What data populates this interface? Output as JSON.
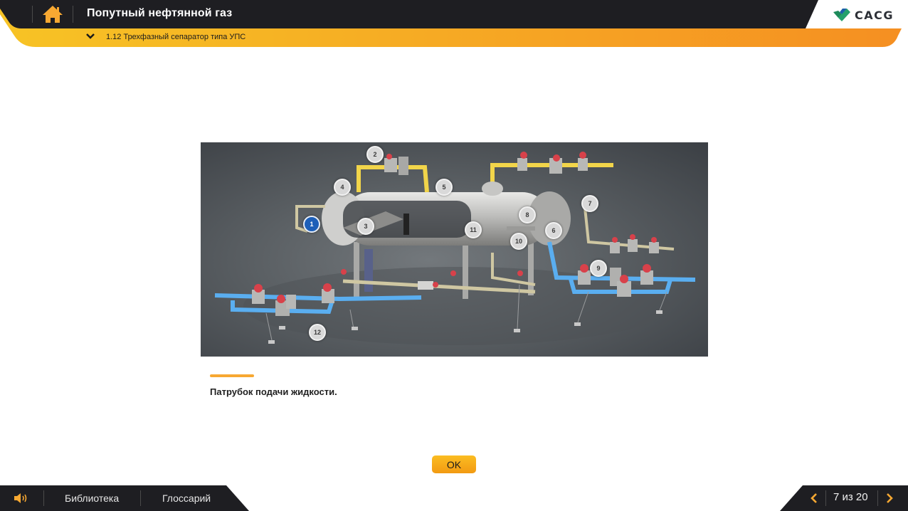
{
  "header": {
    "course_title": "Попутный нефтянной газ",
    "section_title": "1.12 Трехфазный сепаратор типа УПС",
    "logo_text": "CACG"
  },
  "figure": {
    "markers": [
      "1",
      "2",
      "3",
      "4",
      "5",
      "6",
      "7",
      "8",
      "9",
      "10",
      "11",
      "12"
    ],
    "active_marker": "1"
  },
  "description": {
    "text": "Патрубок подачи жидкости."
  },
  "ok_button": {
    "label": "OK"
  },
  "footer": {
    "library_label": "Библиотека",
    "glossary_label": "Глоссарий",
    "page_indicator": "7 из 20"
  },
  "colors": {
    "accent": "#f7a832",
    "header_dark": "#1e1e22",
    "active_marker": "#1d5fb8"
  }
}
